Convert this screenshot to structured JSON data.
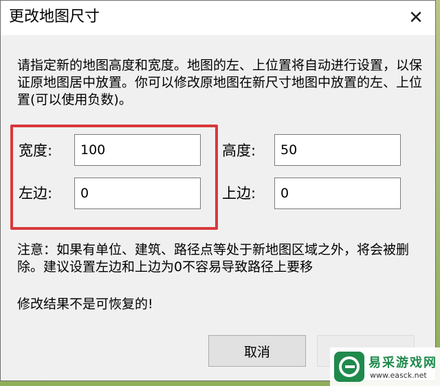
{
  "dialog": {
    "title": "更改地图尺寸",
    "close_glyph": "✕",
    "description": "请指定新的地图高度和宽度。地图的左、上位置将自动进行设置，以保证原地图居中放置。你可以修改原地图在新尺寸地图中放置的左、上位置(可以使用负数)。",
    "fields": {
      "width_label": "宽度:",
      "width_value": "100",
      "height_label": "高度:",
      "height_value": "50",
      "left_label": "左边:",
      "left_value": "0",
      "top_label": "上边:",
      "top_value": "0"
    },
    "note": "注意：如果有单位、建筑、路径点等处于新地图区域之外，将会被删除。建议设置左边和上边为0不容易导致路径上要移",
    "warning": "修改结果不是可恢复的!",
    "cancel_label": "取消"
  },
  "watermark": {
    "name": "易采游戏网",
    "url": "www.easck.net"
  },
  "colors": {
    "highlight": "#d9383a",
    "watermark_green": "#1f8a4c"
  }
}
